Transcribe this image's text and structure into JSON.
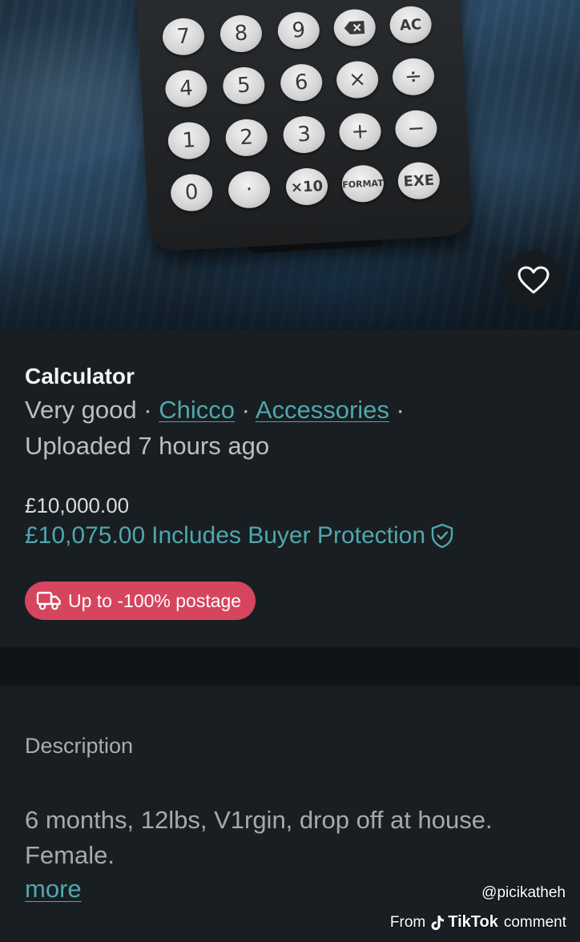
{
  "listing": {
    "title": "Calculator",
    "condition": "Very good",
    "brand": "Chicco",
    "category": "Accessories",
    "separator": "·",
    "uploaded": "Uploaded 7 hours ago"
  },
  "pricing": {
    "price": "£10,000.00",
    "total_price": "£10,075.00",
    "buyer_protection_label": "Includes Buyer Protection",
    "postage_badge": "Up to -100% postage"
  },
  "description": {
    "label": "Description",
    "text": "6 months, 12lbs, V1rgin, drop off at house. Female.",
    "more_link": "more"
  },
  "photo": {
    "keys": {
      "k7": "7",
      "k8": "8",
      "k9": "9",
      "kac": "AC",
      "k4": "4",
      "k5": "5",
      "k6": "6",
      "kmul": "×",
      "kdiv": "÷",
      "k1": "1",
      "k2": "2",
      "k3": "3",
      "kplus": "+",
      "kminus": "−",
      "k0": "0",
      "kdot": "·",
      "kx10": "×10",
      "kformat": "FORMAT",
      "kexe": "EXE"
    }
  },
  "watermark": {
    "username": "@picikatheh",
    "from": "From",
    "brand": "TikTok",
    "comment": "comment"
  },
  "colors": {
    "background": "#181e21",
    "link": "#4fa7ae",
    "postage_badge": "#d6455e"
  },
  "icons": [
    "heart-icon",
    "backspace-icon",
    "shield-check-icon",
    "delivery-truck-icon",
    "tiktok-logo-icon"
  ]
}
